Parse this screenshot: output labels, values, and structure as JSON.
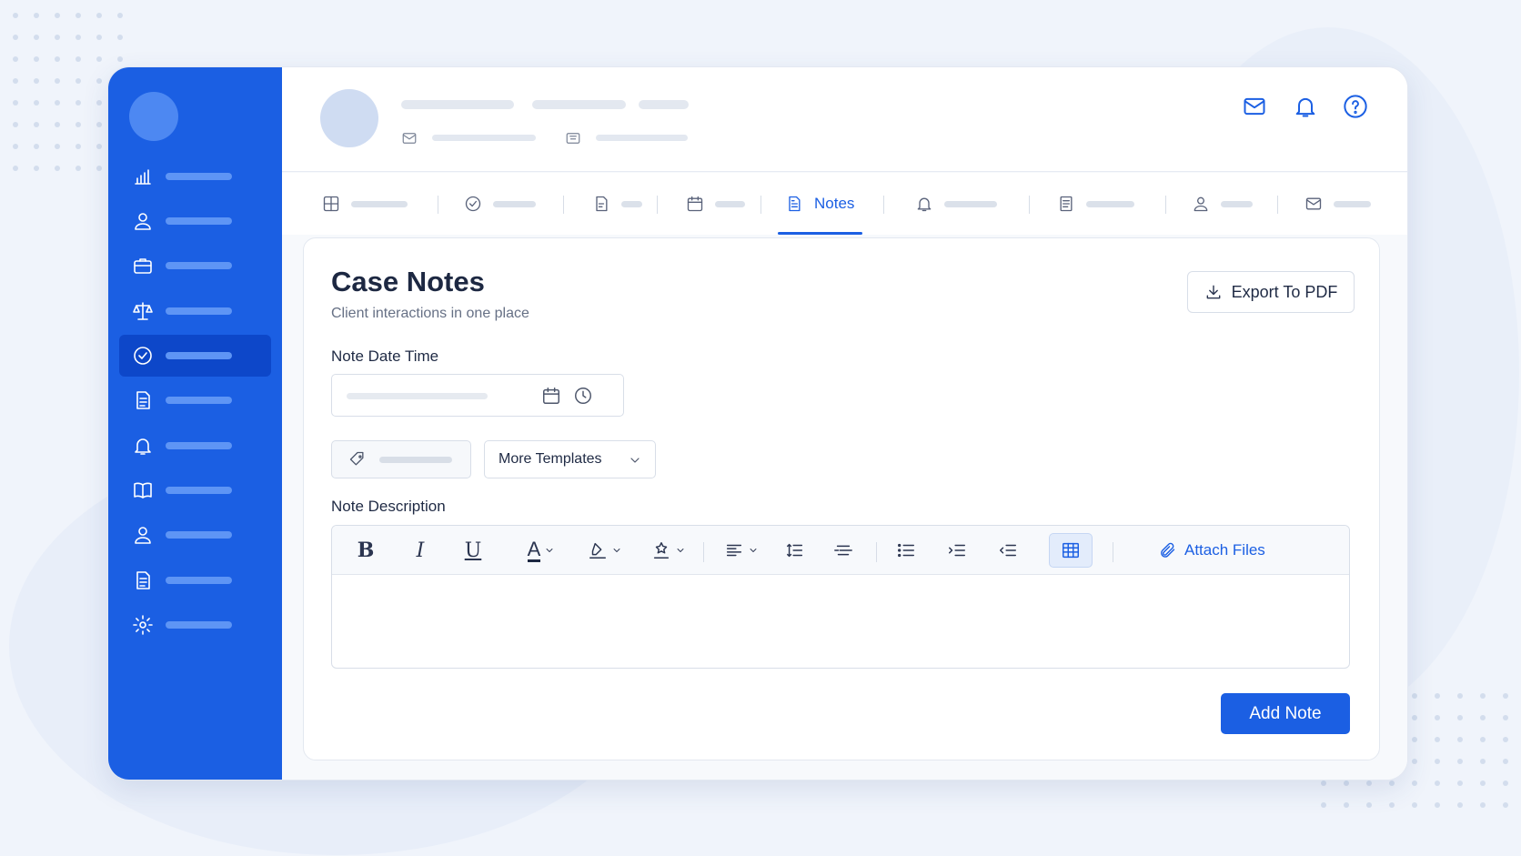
{
  "sidebar": {
    "items": [
      {
        "icon": "bar-chart-icon"
      },
      {
        "icon": "user-icon"
      },
      {
        "icon": "briefcase-icon"
      },
      {
        "icon": "scales-icon"
      },
      {
        "icon": "check-circle-icon",
        "active": true
      },
      {
        "icon": "document-icon"
      },
      {
        "icon": "bell-icon"
      },
      {
        "icon": "book-icon"
      },
      {
        "icon": "user-icon"
      },
      {
        "icon": "document-icon"
      },
      {
        "icon": "gear-icon"
      }
    ]
  },
  "header": {
    "icons": [
      "mail-icon",
      "bell-icon",
      "help-icon"
    ]
  },
  "tabs": {
    "active_label": "Notes",
    "icons": [
      "grid-icon",
      "check-circle-icon",
      "file-icon",
      "calendar-icon",
      "notes-icon",
      "bell-icon",
      "document-icon",
      "user-icon",
      "mail-icon"
    ]
  },
  "card": {
    "title": "Case Notes",
    "subtitle": "Client interactions in one place",
    "export_label": "Export To PDF",
    "date_label": "Note Date Time",
    "templates_label": "More Templates",
    "description_label": "Note Description",
    "toolbar": {
      "bold": "B",
      "italic": "I",
      "underline": "U",
      "font_color": "A",
      "attach_label": "Attach Files"
    },
    "add_label": "Add Note"
  },
  "colors": {
    "accent": "#1b5fe3",
    "sidebar_bg": "#1b5fe3",
    "sidebar_active": "#0d47c9"
  }
}
